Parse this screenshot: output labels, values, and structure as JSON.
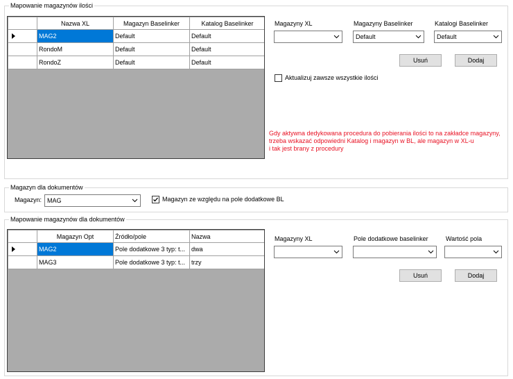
{
  "section_quantity": {
    "legend": "Mapowanie magazynów ilości",
    "columns": [
      "Nazwa XL",
      "Magazyn Baselinker",
      "Katalog Baselinker"
    ],
    "rows": [
      [
        "MAG2",
        "Default",
        "Default"
      ],
      [
        "RondoM",
        "Default",
        "Default"
      ],
      [
        "RondoZ",
        "Default",
        "Default"
      ]
    ],
    "label_magazyny_xl": "Magazyny XL",
    "label_magazyny_bl": "Magazyny Baselinker",
    "label_katalogi_bl": "Katalogi Baselinker",
    "combo_magazyny_xl": "",
    "combo_magazyny_bl": "Default",
    "combo_katalogi_bl": "Default",
    "btn_remove": "Usuń",
    "btn_add": "Dodaj",
    "checkbox_update_all": "Aktualizuj zawsze wszystkie ilości",
    "warning": "Gdy aktywna dedykowana procedura do pobierania ilości to na zakładce magazyny,\ntrzeba wskazać odpowiedni Katalog i magazyn w BL, ale magazyn w XL-u\ni tak jest brany z procedury"
  },
  "section_doc_warehouse": {
    "legend": "Magazyn dla dokumentów",
    "label_magazyn": "Magazyn:",
    "combo_magazyn": "MAG",
    "checkbox_bl_field": "Magazyn ze względu na pole dodatkowe BL",
    "checkbox_bl_field_checked": true
  },
  "section_doc_mapping": {
    "legend": "Mapowanie magazynów dla dokumentów",
    "columns": [
      "Magazyn Opt",
      "Źródło/pole",
      "Nazwa"
    ],
    "rows": [
      [
        "MAG2",
        "Pole dodatkowe 3 typ: t...",
        "dwa"
      ],
      [
        "MAG3",
        "Pole dodatkowe 3 typ: t...",
        "trzy"
      ]
    ],
    "label_magazyny_xl": "Magazyny XL",
    "label_pole_bl": "Pole dodatkowe baselinker",
    "label_wartosc": "Wartość pola",
    "combo_magazyny_xl": "",
    "combo_pole_bl": "",
    "combo_wartosc": "",
    "btn_remove": "Usuń",
    "btn_add": "Dodaj"
  }
}
